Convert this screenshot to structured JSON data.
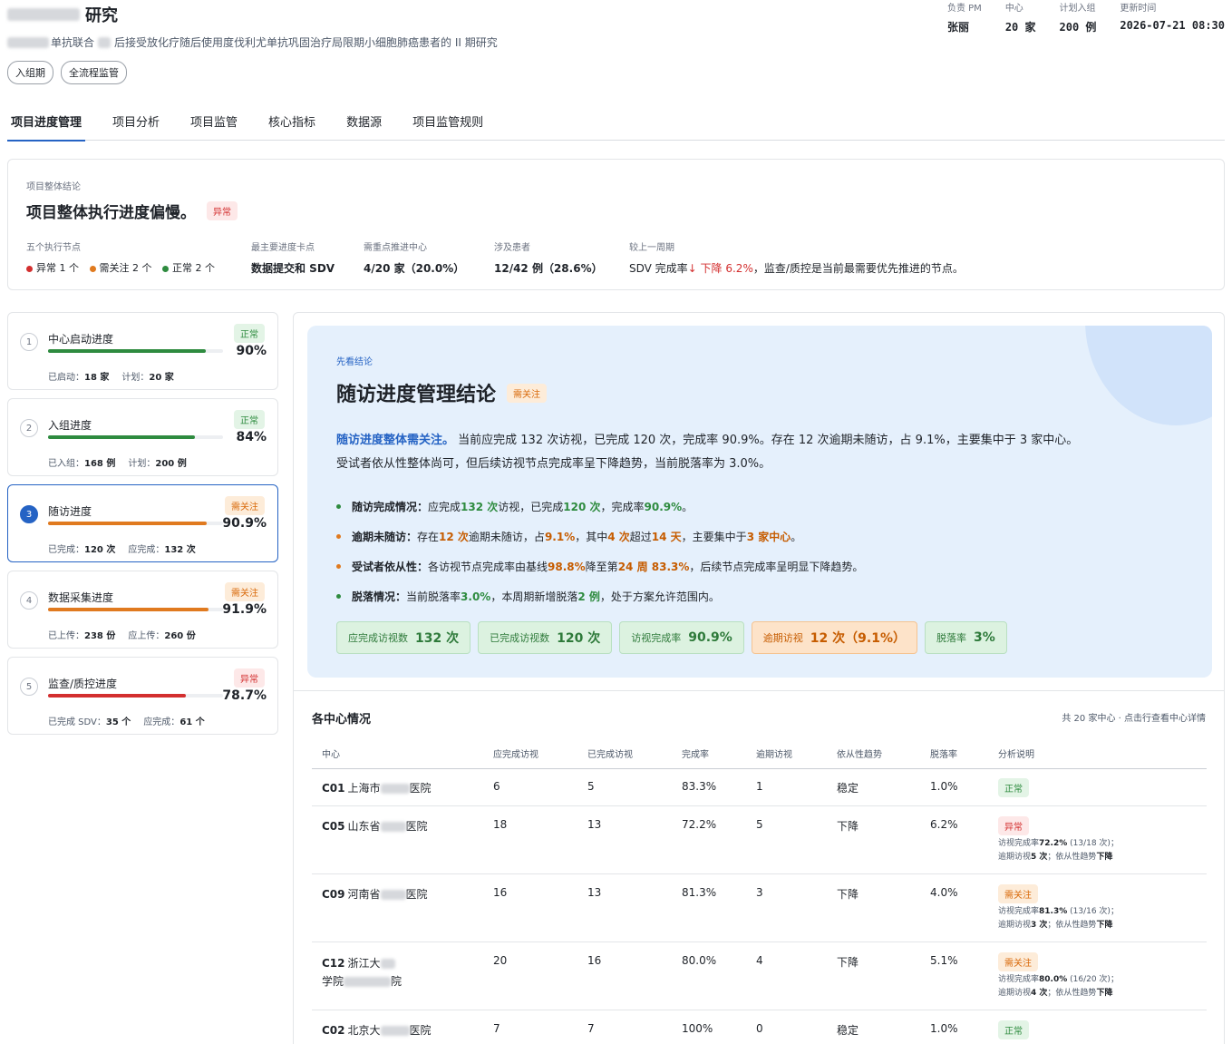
{
  "header": {
    "title_suffix": "研究",
    "subtitle_a": "单抗联合",
    "subtitle_b": "后接受放化疗随后使用度伐利尤单抗巩固治疗局限期小细胞肺癌患者的 II 期研究",
    "tags": [
      "入组期",
      "全流程监管"
    ],
    "meta": [
      {
        "key": "负责 PM",
        "value": "张丽"
      },
      {
        "key": "中心",
        "value": "20 家"
      },
      {
        "key": "计划入组",
        "value": "200 例"
      },
      {
        "key": "更新时间",
        "value": "2026-07-21 08:30"
      }
    ]
  },
  "tabs": [
    "项目进度管理",
    "项目分析",
    "项目监管",
    "核心指标",
    "数据源",
    "项目监管规则"
  ],
  "summary": {
    "label": "项目整体结论",
    "headline": "项目整体执行进度偏慢。",
    "badge": "异常",
    "stats": [
      {
        "key": "五个执行节点",
        "abnormal": "异常 1 个",
        "attention": "需关注 2 个",
        "normal": "正常 2 个"
      },
      {
        "key": "最主要进度卡点",
        "value": "数据提交和 SDV"
      },
      {
        "key": "需重点推进中心",
        "value": "4/20 家（20.0%）"
      },
      {
        "key": "涉及患者",
        "value": "12/42 例（28.6%）"
      },
      {
        "key": "较上一周期",
        "prefix": "SDV 完成率",
        "down": "↓ 下降 6.2%",
        "suffix": "，监查/质控是当前最需要优先推进的节点。"
      }
    ]
  },
  "nodes": [
    {
      "num": "1",
      "name": "中心启动进度",
      "status": "正常",
      "pct": "90%",
      "fill": 0.9,
      "sub1k": "已启动：",
      "sub1v": "18 家",
      "sub2k": "计划：",
      "sub2v": "20 家",
      "color": "#2e8b3f"
    },
    {
      "num": "2",
      "name": "入组进度",
      "status": "正常",
      "pct": "84%",
      "fill": 0.84,
      "sub1k": "已入组：",
      "sub1v": "168 例",
      "sub2k": "计划：",
      "sub2v": "200 例",
      "color": "#2e8b3f"
    },
    {
      "num": "3",
      "name": "随访进度",
      "status": "需关注",
      "pct": "90.9%",
      "fill": 0.909,
      "sub1k": "已完成：",
      "sub1v": "120 次",
      "sub2k": "应完成：",
      "sub2v": "132 次",
      "color": "#e07a1f"
    },
    {
      "num": "4",
      "name": "数据采集进度",
      "status": "需关注",
      "pct": "91.9%",
      "fill": 0.919,
      "sub1k": "已上传：",
      "sub1v": "238 份",
      "sub2k": "应上传：",
      "sub2v": "260 份",
      "color": "#e07a1f"
    },
    {
      "num": "5",
      "name": "监查/质控进度",
      "status": "异常",
      "pct": "78.7%",
      "fill": 0.787,
      "sub1k": "已完成 SDV：",
      "sub1v": "35 个",
      "sub2k": "应完成：",
      "sub2v": "61 个",
      "color": "#d32f2f"
    }
  ],
  "hero": {
    "pre": "先看结论",
    "title": "随访进度管理结论",
    "badge": "需关注",
    "para_hl": "随访进度整体需关注。",
    "para_1": " 当前应完成 132 次访视，已完成 120 次，完成率 90.9%。存在 12 次逾期未随访，占 9.1%，主要集中于 3 家中心。",
    "para_2": "受试者依从性整体尚可，但后续访视节点完成率呈下降趋势，当前脱落率为 3.0%。",
    "bullets": [
      {
        "k": "随访完成情况：",
        "t1": "应完成 ",
        "v1": "132 次",
        "t2": "访视，已完成 ",
        "v2": "120 次",
        "t3": "，完成率 ",
        "v3": "90.9%",
        "t4": "。"
      },
      {
        "k": "逾期未随访：",
        "t1": "存在 ",
        "v1": "12 次",
        "t2": "逾期未随访，占 ",
        "v2": "9.1%",
        "t3": "，其中 ",
        "v3": "4 次",
        "t4": "超过 ",
        "v4": "14 天",
        "t5": "，主要集中于 ",
        "v5": "3 家中心",
        "t6": "。"
      },
      {
        "k": "受试者依从性：",
        "t1": "各访视节点完成率由基线 ",
        "v1": "98.8%",
        "t2": " 降至第 ",
        "v2": "24 周 83.3%",
        "t3": "，后续节点完成率呈明显下降趋势。"
      },
      {
        "k": "脱落情况：",
        "t1": "当前脱落率 ",
        "v1": "3.0%",
        "t2": "，本周期新增脱落 ",
        "v2": "2 例",
        "t3": "，处于方案允许范围内。"
      }
    ],
    "chips": [
      {
        "k": "应完成访视数",
        "v": "132 次"
      },
      {
        "k": "已完成访视数",
        "v": "120 次"
      },
      {
        "k": "访视完成率",
        "v": "90.9%"
      },
      {
        "k": "逾期访视",
        "v": "12 次（9.1%）"
      },
      {
        "k": "脱落率",
        "v": "3%"
      }
    ]
  },
  "table": {
    "title": "各中心情况",
    "note": "共 20 家中心 · 点击行查看中心详情",
    "headers": [
      "中心",
      "应完成访视",
      "已完成访视",
      "完成率",
      "逾期访视",
      "依从性趋势",
      "脱落率",
      "分析说明"
    ],
    "rows": [
      {
        "code": "C01",
        "name_a": "上海市",
        "name_b": "医院",
        "due": "6",
        "done": "5",
        "rate": "83.3%",
        "overdue": "1",
        "trend": "稳定",
        "drop": "1.0%",
        "status": "正常"
      },
      {
        "code": "C05",
        "name_a": "山东省",
        "name_b": "医院",
        "due": "18",
        "done": "13",
        "rate": "72.2%",
        "overdue": "5",
        "trend": "下降",
        "drop": "6.2%",
        "status": "异常",
        "n1": "访视完成率",
        "n1v": "72.2%",
        "n1p": "(13/18 次)；",
        "n2": "逾期访视",
        "n2v": "5 次",
        "n3": "；依从性趋势",
        "n3v": "下降"
      },
      {
        "code": "C09",
        "name_a": "河南省",
        "name_b": "医院",
        "due": "16",
        "done": "13",
        "rate": "81.3%",
        "overdue": "3",
        "trend": "下降",
        "drop": "4.0%",
        "status": "需关注",
        "n1": "访视完成率",
        "n1v": "81.3%",
        "n1p": "(13/16 次)；",
        "n2": "逾期访视",
        "n2v": "3 次",
        "n3": "；依从性趋势",
        "n3v": "下降"
      },
      {
        "code": "C12",
        "name_a": "浙江大",
        "name_c": "学院",
        "name_b": "院",
        "due": "20",
        "done": "16",
        "rate": "80.0%",
        "overdue": "4",
        "trend": "下降",
        "drop": "5.1%",
        "status": "需关注",
        "n1": "访视完成率",
        "n1v": "80.0%",
        "n1p": "(16/20 次)；",
        "n2": "逾期访视",
        "n2v": "4 次",
        "n3": "；依从性趋势",
        "n3v": "下降"
      },
      {
        "code": "C02",
        "name_a": "北京大",
        "name_b": "医院",
        "due": "7",
        "done": "7",
        "rate": "100%",
        "overdue": "0",
        "trend": "稳定",
        "drop": "1.0%",
        "status": "正常"
      }
    ]
  },
  "colors": {
    "accent": "#2563c4",
    "normal": "#2e8b3f",
    "attention": "#e07a1f",
    "abnormal": "#d32f2f"
  }
}
